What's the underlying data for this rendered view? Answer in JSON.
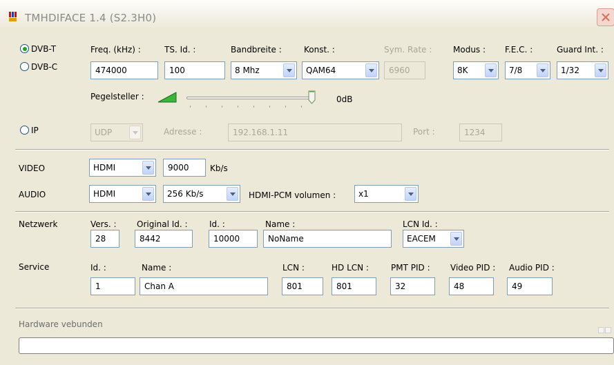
{
  "window": {
    "title": "TMHDIFACE 1.4 (S2.3H0)"
  },
  "tuner": {
    "modes": [
      {
        "label": "DVB-T",
        "checked": true
      },
      {
        "label": "DVB-C",
        "checked": false
      }
    ],
    "freq": {
      "label": "Freq. (kHz) :",
      "value": "474000"
    },
    "ts_id": {
      "label": "TS. Id. :",
      "value": "100"
    },
    "bandwidth": {
      "label": "Bandbreite :",
      "value": "8 Mhz"
    },
    "konst": {
      "label": "Konst. :",
      "value": "QAM64"
    },
    "sym_rate": {
      "label": "Sym. Rate :",
      "value": "6960"
    },
    "modus": {
      "label": "Modus :",
      "value": "8K"
    },
    "fec": {
      "label": "F.E.C. :",
      "value": "7/8"
    },
    "guard": {
      "label": "Guard Int. :",
      "value": "1/32"
    },
    "pegel": {
      "label": "Pegelsteller :",
      "value_label": "0dB",
      "level": 1.0
    }
  },
  "ip": {
    "label": "IP",
    "protocol": "UDP",
    "address_label": "Adresse :",
    "address": "192.168.1.11",
    "port_label": "Port :",
    "port": "1234"
  },
  "video": {
    "label": "VIDEO",
    "source": "HDMI",
    "bitrate": "9000",
    "unit": "Kb/s"
  },
  "audio": {
    "label": "AUDIO",
    "source": "HDMI",
    "bitrate": "256 Kb/s",
    "volume_label": "HDMI-PCM volumen :",
    "volume": "x1"
  },
  "netzwerk": {
    "label": "Netzwerk",
    "vers_label": "Vers. :",
    "vers": "28",
    "orig_id_label": "Original Id. :",
    "orig_id": "8442",
    "id_label": "Id. :",
    "id": "10000",
    "name_label": "Name :",
    "name": "NoName",
    "lcn_id_label": "LCN Id. :",
    "lcn_id": "EACEM"
  },
  "service": {
    "label": "Service",
    "id_label": "Id. :",
    "id": "1",
    "name_label": "Name :",
    "name": "Chan A",
    "lcn_label": "LCN :",
    "lcn": "801",
    "hd_lcn_label": "HD LCN :",
    "hd_lcn": "801",
    "pmt_label": "PMT PID :",
    "pmt": "32",
    "video_pid_label": "Video PID :",
    "video_pid": "48",
    "audio_pid_label": "Audio PID :",
    "audio_pid": "49"
  },
  "status": {
    "text": "Hardware vebunden",
    "progress": 0
  },
  "colors": {
    "radio_dot": "#21a121",
    "field_border": "#7f9db9",
    "window_bg": "#ece9d8"
  }
}
